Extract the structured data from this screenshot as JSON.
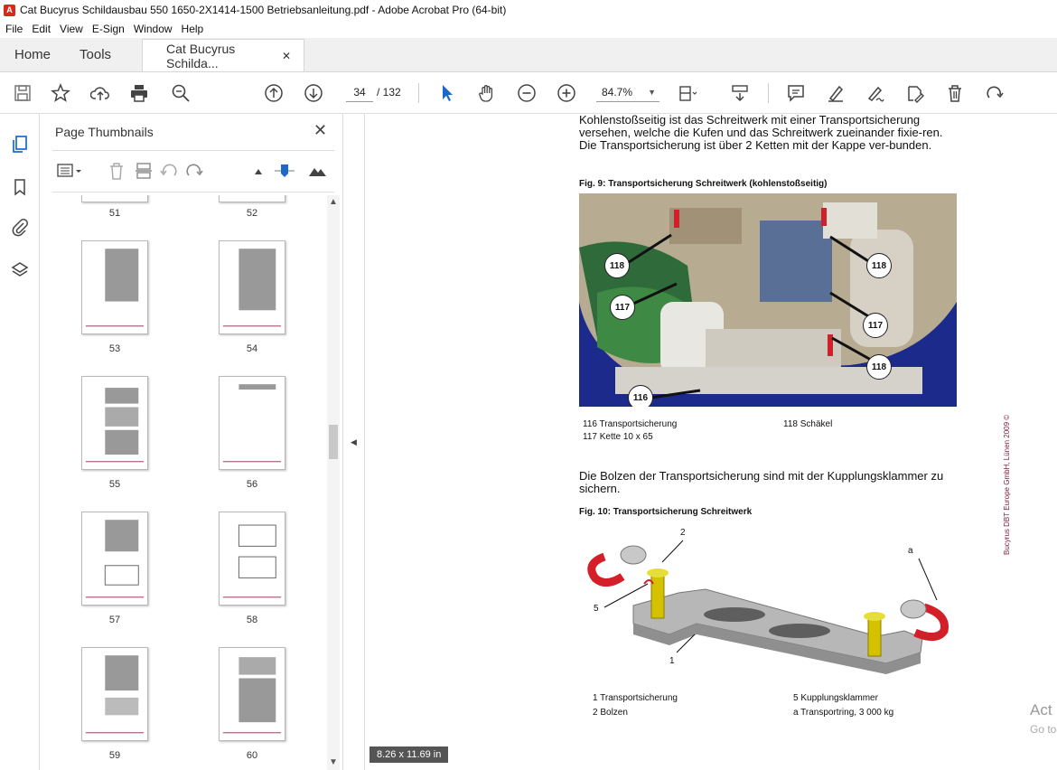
{
  "window": {
    "title": "Cat Bucyrus Schildausbau 550 1650-2X1414-1500 Betriebsanleitung.pdf - Adobe Acrobat Pro (64-bit)"
  },
  "menu": [
    "File",
    "Edit",
    "View",
    "E-Sign",
    "Window",
    "Help"
  ],
  "tabs": {
    "home": "Home",
    "tools": "Tools",
    "doc": "Cat Bucyrus Schilda..."
  },
  "toolbar": {
    "page_current": "34",
    "page_total": "/ 132",
    "zoom": "84.7%"
  },
  "thumbnails": {
    "title": "Page Thumbnails",
    "pages": [
      "51",
      "52",
      "53",
      "54",
      "55",
      "56",
      "57",
      "58",
      "59",
      "60"
    ]
  },
  "document": {
    "para1": "Kohlenstoßseitig ist das Schreitwerk mit einer Transportsicherung versehen, welche die Kufen und das Schreitwerk zueinander fixie-ren. Die Transportsicherung ist über 2 Ketten mit der Kappe ver-bunden.",
    "fig9_caption": "Fig. 9:    Transportsicherung Schreitwerk (kohlenstoßseitig)",
    "fig9_callouts": [
      "118",
      "118",
      "117",
      "117",
      "118",
      "116"
    ],
    "legend9": {
      "l116": "116  Transportsicherung",
      "l117": "117  Kette 10 x 65",
      "l118": "118  Schäkel"
    },
    "para2": "Die Bolzen der Transportsicherung sind mit der Kupplungsklammer zu sichern.",
    "fig10_caption": "Fig. 10:  Transportsicherung Schreitwerk",
    "fig10_labels": [
      "2",
      "a",
      "5",
      "1"
    ],
    "legend10": {
      "l1": "1  Transportsicherung",
      "l2": "2  Bolzen",
      "l5": "5  Kupplungsklammer",
      "la": "a  Transportring, 3 000 kg"
    },
    "side_note": "Bucyrus DBT Europe GmbH, Lünen 2009 ©"
  },
  "status": {
    "page_size": "8.26 x 11.69 in"
  },
  "watermark": {
    "line1": "Act",
    "line2": "Go to"
  }
}
